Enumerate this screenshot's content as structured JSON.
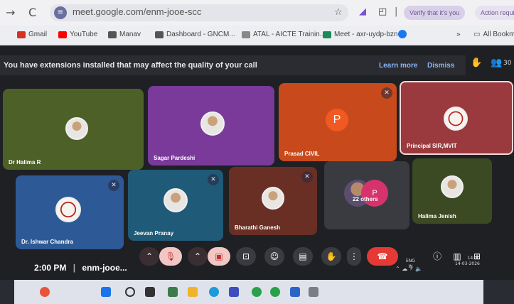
{
  "browser": {
    "url": "meet.google.com/enm-jooe-scc",
    "pill_verify": "Verify that it's you",
    "pill_action": "Action requi",
    "bookmarks": [
      {
        "label": "Gmail",
        "color": "#d93025"
      },
      {
        "label": "YouTube",
        "color": "#ff0000"
      },
      {
        "label": "Manav",
        "color": "#555555"
      },
      {
        "label": "Dashboard - GNCM...",
        "color": "#555555"
      },
      {
        "label": "ATAL - AICTE Trainin...",
        "color": "#888888"
      },
      {
        "label": "Meet - axr-uydp-bzn",
        "color": "#1a8a5a"
      }
    ],
    "more_bookmarks": "»",
    "all_bookmarks": "All Bookm"
  },
  "banner": {
    "message": "You have extensions installed that may affect the quality of your call",
    "learn_more": "Learn more",
    "dismiss": "Dismiss",
    "people_count": "30"
  },
  "participants": [
    {
      "name": "Dr Halima R",
      "bg": "#4d6028",
      "avatar": "photo",
      "muted": false
    },
    {
      "name": "Sagar Pardeshi",
      "bg": "#7a3a9a",
      "avatar": "photo",
      "muted": false
    },
    {
      "name": "Prasad CIVIL",
      "bg": "#c84a1c",
      "avatar": "letter",
      "letter": "P",
      "letter_color": "#f05a22",
      "muted": true
    },
    {
      "name": "Principal SIR,MVIT",
      "bg": "#9a3a3e",
      "avatar": "logo",
      "muted": false,
      "active": true
    },
    {
      "name": "Dr. Ishwar Chandra",
      "bg": "#2d5a96",
      "avatar": "logo",
      "muted": true
    },
    {
      "name": "Jeevan Pranay",
      "bg": "#1f5a78",
      "avatar": "photo",
      "muted": true
    },
    {
      "name": "Bharathi Ganesh",
      "bg": "#6a2f24",
      "avatar": "photo",
      "muted": true
    },
    {
      "name": "22 others",
      "bg": "#3a3b40",
      "avatar": "group",
      "letter": "P",
      "letter_color": "#d6336c",
      "muted": false
    },
    {
      "name": "Halima Jenish",
      "bg": "#3b4a22",
      "avatar": "photo",
      "muted": false
    }
  ],
  "meeting": {
    "time": "2:00 PM",
    "separator": "|",
    "code": "enm-jooe..."
  },
  "taskbar": {
    "lang": "ENG",
    "region": "IN",
    "time": "14:00",
    "date": "14-03-2026"
  },
  "colors": {
    "leave": "#e53935",
    "mic_off_bg": "#f2c6c3",
    "accent_link": "#8ab4f8"
  }
}
